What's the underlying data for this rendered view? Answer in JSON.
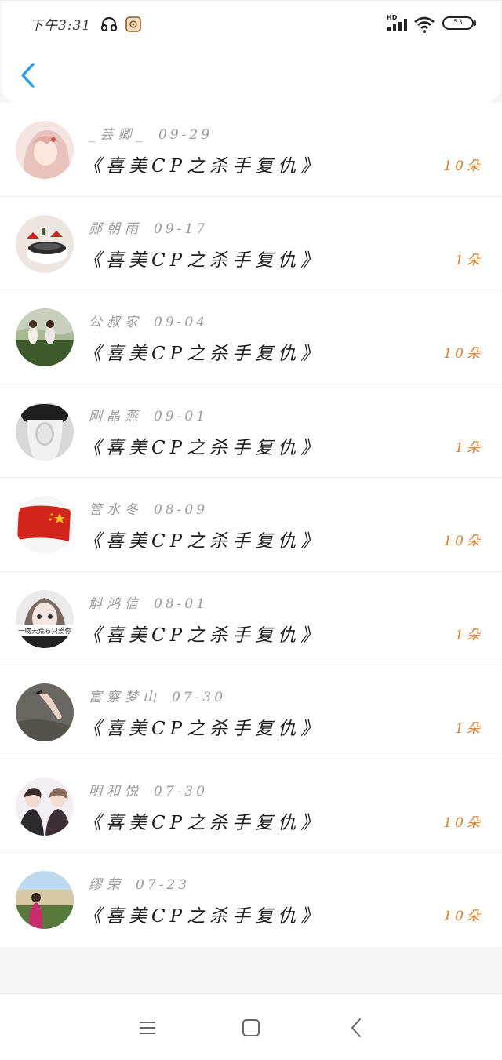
{
  "status_bar": {
    "time": "下午3:31",
    "network_label": "HD",
    "battery": "53",
    "icons": [
      "headphone-icon",
      "app-badge-icon",
      "signal-icon",
      "wifi-icon",
      "battery-icon"
    ]
  },
  "header": {
    "back_icon": "chevron-left-icon",
    "accent_color": "#2b9ae8"
  },
  "list": {
    "items": [
      {
        "name": "_芸卿_",
        "date": "09-29",
        "title": "《喜美CP之杀手复仇》",
        "count": "10朵"
      },
      {
        "name": "郧朝雨",
        "date": "09-17",
        "title": "《喜美CP之杀手复仇》",
        "count": "1朵"
      },
      {
        "name": "公叔家",
        "date": "09-04",
        "title": "《喜美CP之杀手复仇》",
        "count": "10朵"
      },
      {
        "name": "刚晶燕",
        "date": "09-01",
        "title": "《喜美CP之杀手复仇》",
        "count": "1朵"
      },
      {
        "name": "管水冬",
        "date": "08-09",
        "title": "《喜美CP之杀手复仇》",
        "count": "10朵"
      },
      {
        "name": "斛鸿信",
        "date": "08-01",
        "title": "《喜美CP之杀手复仇》",
        "count": "1朵"
      },
      {
        "name": "富察梦山",
        "date": "07-30",
        "title": "《喜美CP之杀手复仇》",
        "count": "1朵"
      },
      {
        "name": "明和悦",
        "date": "07-30",
        "title": "《喜美CP之杀手复仇》",
        "count": "10朵"
      },
      {
        "name": "缪荣",
        "date": "07-23",
        "title": "《喜美CP之杀手复仇》",
        "count": "10朵"
      }
    ],
    "avatar_5_caption": "一吻天荒ら只爱你",
    "count_color": "#d9812f"
  },
  "nav_bar": {
    "icons": [
      "menu-icon",
      "home-icon",
      "back-icon"
    ]
  }
}
